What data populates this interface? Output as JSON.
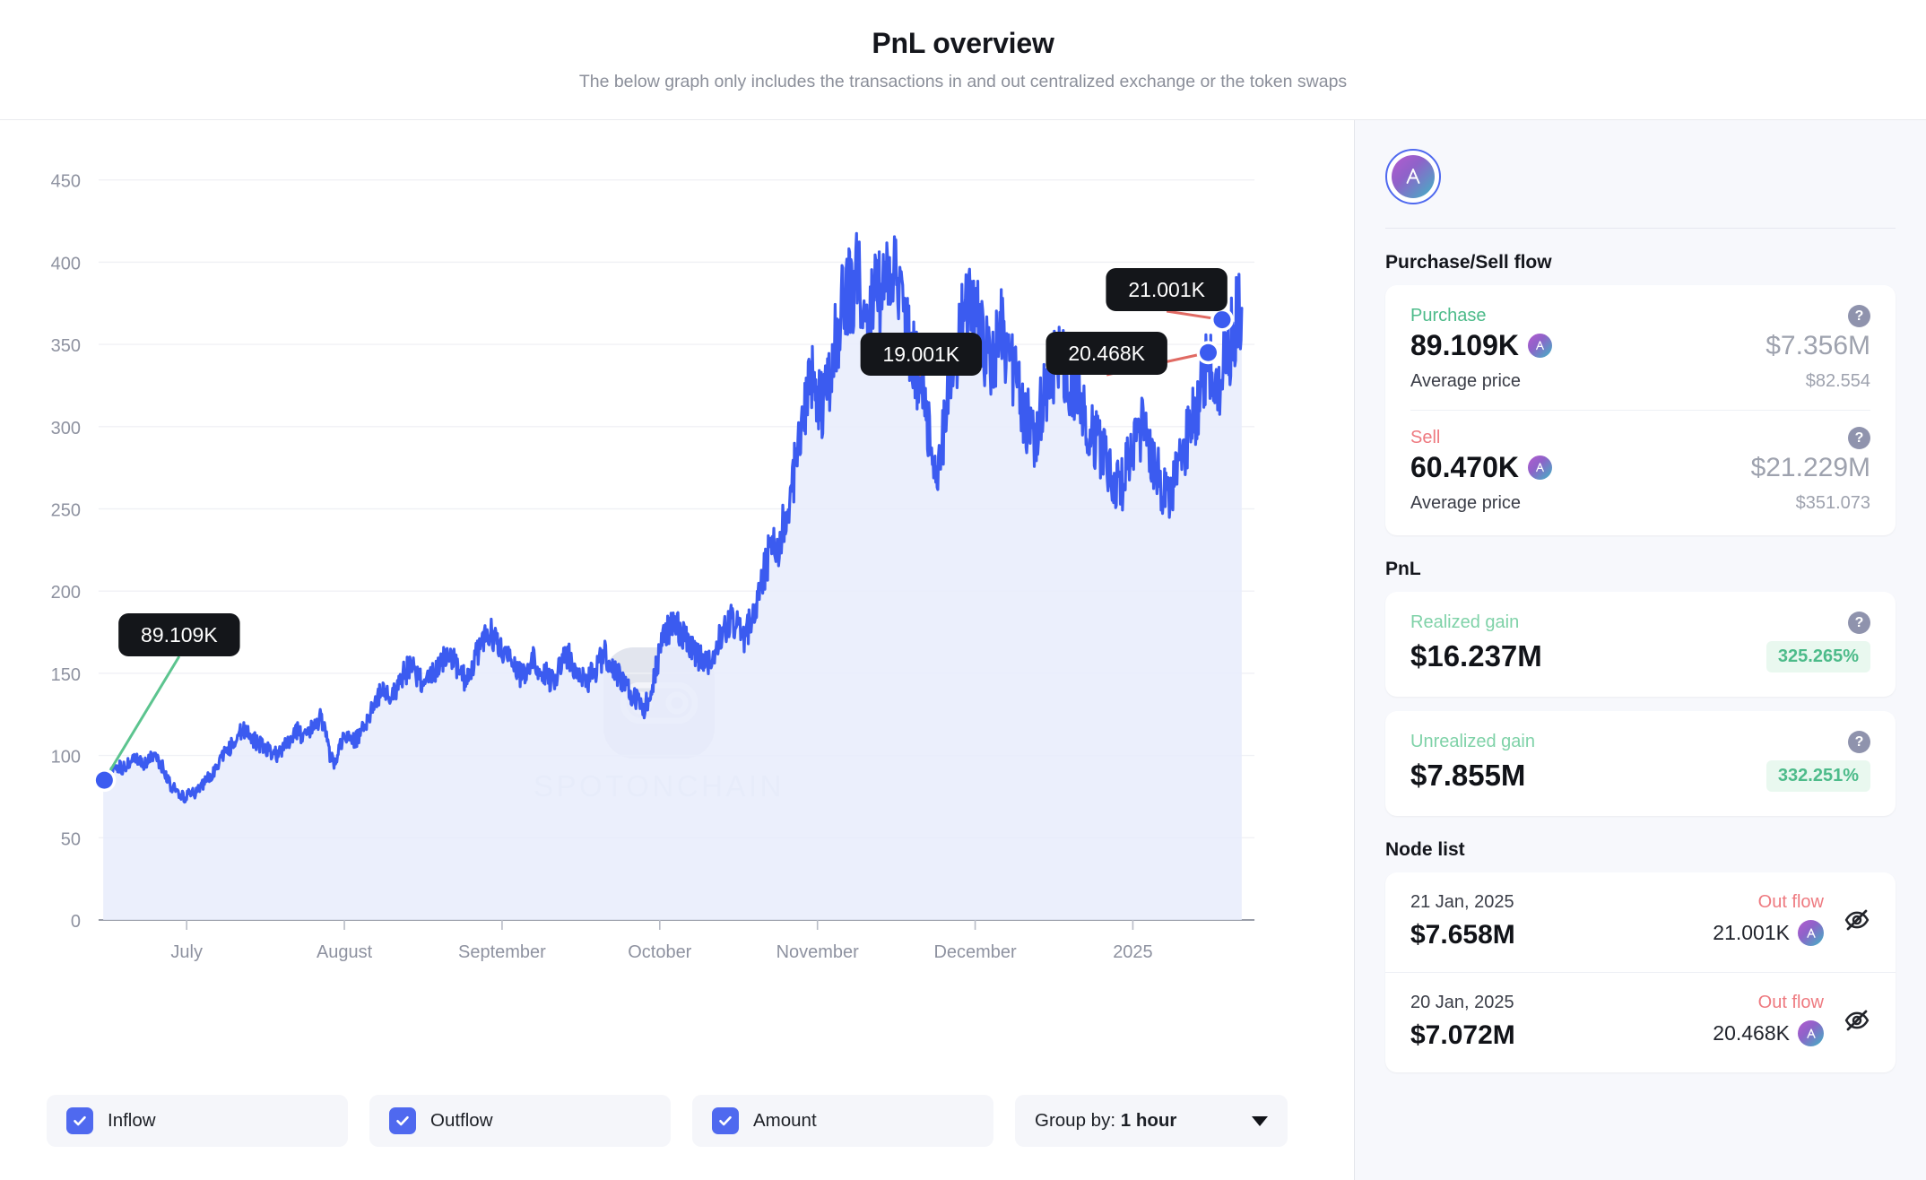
{
  "header": {
    "title": "PnL overview",
    "subtitle": "The below graph only includes the transactions in and out centralized exchange or the token swaps"
  },
  "watermark": {
    "text": "SPOTONCHAIN",
    "logo_icon": "spotonchain-goggles-icon"
  },
  "chart_data": {
    "type": "area",
    "title": "PnL overview",
    "xlabel": "",
    "ylabel": "",
    "ylim": [
      0,
      470
    ],
    "yticks": [
      0,
      50,
      100,
      150,
      200,
      250,
      300,
      350,
      400,
      450
    ],
    "xtick_labels": [
      "July",
      "August",
      "September",
      "October",
      "November",
      "December",
      "2025"
    ],
    "grid": true,
    "legend_position": "bottom",
    "series": [
      {
        "name": "Amount",
        "color": "#3b5bf0",
        "fill": "#e8ecfb",
        "values": [
          85,
          88,
          92,
          94,
          91,
          95,
          96,
          97,
          95,
          96,
          98,
          97,
          95,
          88,
          82,
          79,
          76,
          74,
          78,
          77,
          80,
          84,
          87,
          90,
          95,
          100,
          104,
          108,
          112,
          116,
          113,
          110,
          108,
          106,
          104,
          102,
          100,
          103,
          107,
          112,
          116,
          113,
          110,
          116,
          119,
          122,
          118,
          100,
          96,
          105,
          112,
          110,
          108,
          112,
          118,
          124,
          130,
          136,
          140,
          138,
          136,
          142,
          148,
          152,
          156,
          150,
          146,
          143,
          147,
          152,
          158,
          162,
          160,
          155,
          150,
          146,
          152,
          158,
          164,
          170,
          175,
          172,
          168,
          163,
          158,
          155,
          150,
          147,
          152,
          158,
          155,
          152,
          148,
          145,
          150,
          156,
          161,
          158,
          152,
          147,
          144,
          148,
          152,
          157,
          162,
          158,
          153,
          148,
          144,
          140,
          136,
          132,
          128,
          135,
          145,
          158,
          170,
          176,
          180,
          178,
          174,
          170,
          166,
          162,
          158,
          155,
          160,
          166,
          172,
          178,
          184,
          180,
          176,
          172,
          180,
          190,
          200,
          212,
          222,
          232,
          228,
          240,
          252,
          268,
          285,
          300,
          318,
          330,
          322,
          310,
          325,
          340,
          355,
          368,
          380,
          385,
          392,
          386,
          378,
          370,
          375,
          382,
          390,
          396,
          388,
          375,
          360,
          348,
          340,
          332,
          320,
          300,
          285,
          272,
          290,
          310,
          330,
          348,
          360,
          370,
          376,
          368,
          356,
          344,
          336,
          348,
          360,
          352,
          340,
          330,
          320,
          310,
          300,
          295,
          305,
          316,
          326,
          338,
          348,
          342,
          334,
          326,
          318,
          310,
          302,
          296,
          290,
          284,
          278,
          272,
          268,
          262,
          272,
          282,
          292,
          300,
          290,
          280,
          275,
          268,
          262,
          258,
          266,
          276,
          286,
          296,
          306,
          316,
          326,
          336,
          330,
          322,
          334,
          346,
          356,
          364,
          372
        ]
      }
    ],
    "annotations": [
      {
        "label": "89.109K",
        "kind": "inflow",
        "color": "#5cc48f",
        "point_x_pct": 0.5,
        "point_y_value": 85
      },
      {
        "label": "19.001K",
        "kind": "outflow",
        "color": "#e06a63",
        "point_x_pct": 69.5,
        "point_y_value": 340
      },
      {
        "label": "20.468K",
        "kind": "outflow",
        "color": "#e06a63",
        "point_x_pct": 96.0,
        "point_y_value": 345
      },
      {
        "label": "21.001K",
        "kind": "outflow",
        "color": "#e06a63",
        "point_x_pct": 97.2,
        "point_y_value": 365
      }
    ]
  },
  "controls": {
    "inflow_label": "Inflow",
    "inflow_checked": true,
    "outflow_label": "Outflow",
    "outflow_checked": true,
    "amount_label": "Amount",
    "amount_checked": true,
    "group_by_prefix": "Group by: ",
    "group_by_value": "1 hour"
  },
  "sidebar": {
    "token_icon": "aave-token-icon",
    "purchase_sell": {
      "section_title": "Purchase/Sell flow",
      "purchase": {
        "label": "Purchase",
        "amount": "89.109K",
        "usd": "$7.356M",
        "avg_label": "Average price",
        "avg_value": "$82.554",
        "help_icon": "question-mark-icon",
        "color": "#4dbb8a"
      },
      "sell": {
        "label": "Sell",
        "amount": "60.470K",
        "usd": "$21.229M",
        "avg_label": "Average price",
        "avg_value": "$351.073",
        "help_icon": "question-mark-icon",
        "color": "#ee7a80"
      }
    },
    "pnl": {
      "section_title": "PnL",
      "realized": {
        "label": "Realized gain",
        "value": "$16.237M",
        "percent": "325.265%",
        "help_icon": "question-mark-icon"
      },
      "unrealized": {
        "label": "Unrealized gain",
        "value": "$7.855M",
        "percent": "332.251%",
        "help_icon": "question-mark-icon"
      }
    },
    "node_list": {
      "section_title": "Node list",
      "rows": [
        {
          "date": "21 Jan, 2025",
          "usd": "$7.658M",
          "flow": "Out flow",
          "amount": "21.001K",
          "toggle_icon": "eye-off-icon"
        },
        {
          "date": "20 Jan, 2025",
          "usd": "$7.072M",
          "flow": "Out flow",
          "amount": "20.468K",
          "toggle_icon": "eye-off-icon"
        }
      ]
    }
  }
}
